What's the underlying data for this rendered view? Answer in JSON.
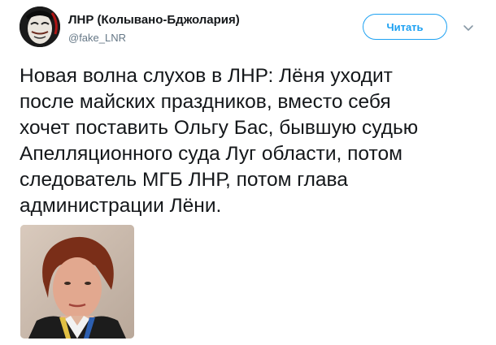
{
  "header": {
    "display_name": "ЛНР (Колывано-Бджолария)",
    "handle": "@fake_LNR",
    "follow_label": "Читать",
    "avatar_icon": "masked-face-avatar",
    "menu_icon": "chevron-down-icon"
  },
  "tweet": {
    "text": "Новая волна слухов в ЛНР: Лёня уходит\nпосле майских праздников, вместо себя\nхочет поставить Ольгу Бас, бывшую судью\nАпелляционного суда Луг области, потом\nследователь МГБ ЛНР, потом глава\nадминистрации Лёни."
  },
  "colors": {
    "accent": "#1da1f2",
    "text": "#14171a",
    "secondary_text": "#657786"
  }
}
